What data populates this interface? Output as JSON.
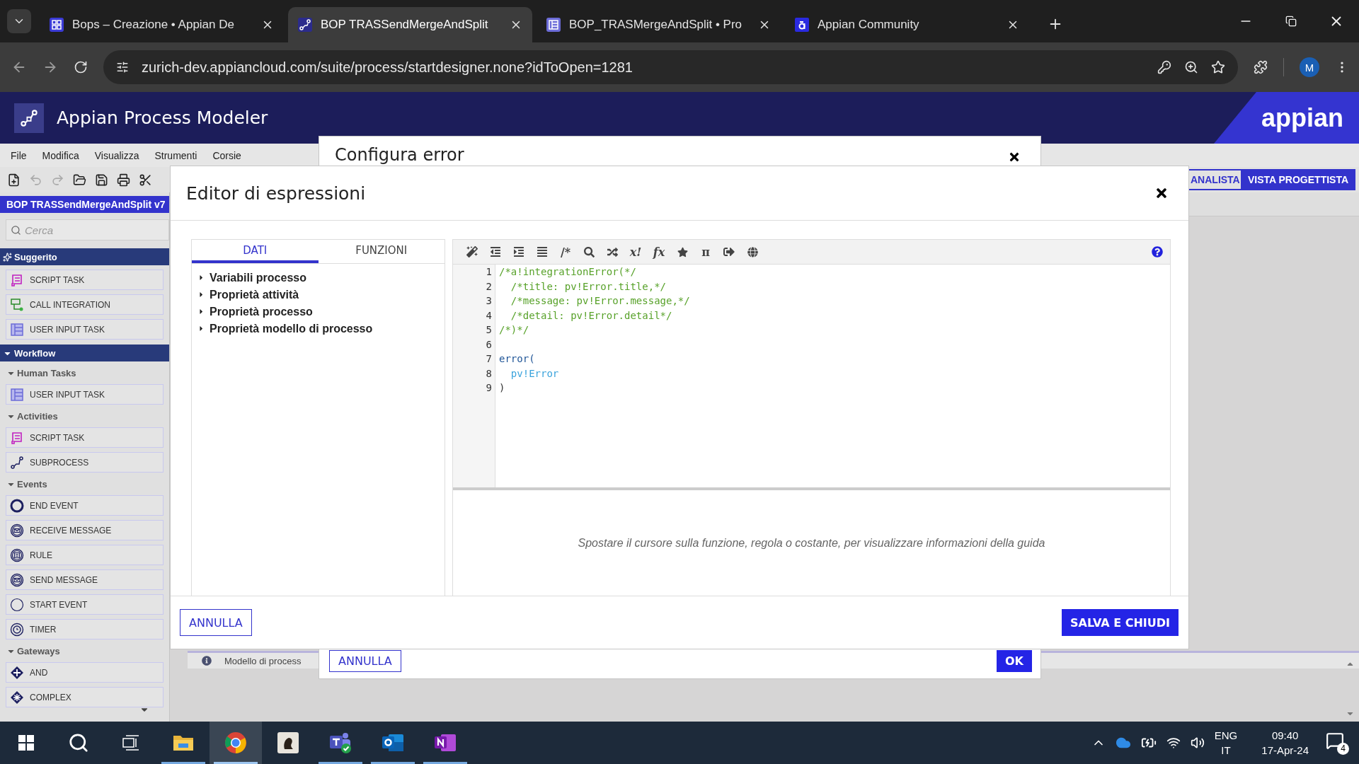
{
  "browser": {
    "tabs": [
      {
        "title": "Bops – Creazione • Appian De",
        "kind": "grid",
        "selected": false
      },
      {
        "title": "BOP TRASSendMergeAndSplit",
        "kind": "flow",
        "selected": true
      },
      {
        "title": "BOP_TRASMergeAndSplit • Pro",
        "kind": "form",
        "selected": false
      },
      {
        "title": "Appian Community",
        "kind": "community",
        "selected": false
      }
    ],
    "url": "zurich-dev.appiancloud.com/suite/process/startdesigner.none?idToOpen=1281",
    "profile": "M"
  },
  "app": {
    "title": "Appian Process Modeler",
    "brand": "appian",
    "menu": [
      "File",
      "Modifica",
      "Visualizza",
      "Strumenti",
      "Corsie"
    ],
    "views": [
      {
        "label": "ANALISTA",
        "selected": false
      },
      {
        "label": "VISTA PROGETTISTA",
        "selected": true
      }
    ],
    "model_title": "BOP TRASSendMergeAndSplit v7",
    "search": {
      "placeholder": "Cerca"
    },
    "palette": [
      {
        "label": "Suggerito",
        "kind": "suggested",
        "items": [
          {
            "label": "SCRIPT TASK",
            "kind": "script-task"
          },
          {
            "label": "CALL INTEGRATION",
            "kind": "call-integration"
          },
          {
            "label": "USER INPUT TASK",
            "kind": "user-input-task"
          }
        ]
      },
      {
        "label": "Workflow",
        "kind": "category",
        "expanded": true,
        "groups": [
          {
            "label": "Human Tasks",
            "expanded": true,
            "items": [
              {
                "label": "USER INPUT TASK",
                "kind": "user-input-task"
              }
            ]
          },
          {
            "label": "Activities",
            "expanded": true,
            "items": [
              {
                "label": "SCRIPT TASK",
                "kind": "script-task"
              },
              {
                "label": "SUBPROCESS",
                "kind": "subprocess"
              }
            ]
          },
          {
            "label": "Events",
            "expanded": true,
            "items": [
              {
                "label": "END EVENT",
                "kind": "end-event"
              },
              {
                "label": "RECEIVE MESSAGE",
                "kind": "receive-message"
              },
              {
                "label": "RULE",
                "kind": "rule"
              },
              {
                "label": "SEND MESSAGE",
                "kind": "send-message"
              },
              {
                "label": "START EVENT",
                "kind": "start-event"
              },
              {
                "label": "TIMER",
                "kind": "timer"
              }
            ]
          },
          {
            "label": "Gateways",
            "expanded": true,
            "items": [
              {
                "label": "AND",
                "kind": "and"
              },
              {
                "label": "COMPLEX",
                "kind": "complex"
              }
            ]
          }
        ]
      }
    ],
    "status_bar": "Modello di process"
  },
  "config_dialog": {
    "title": "Configura error",
    "cancel": "ANNULLA",
    "ok": "OK"
  },
  "editor_dialog": {
    "title": "Editor di espressioni",
    "tabs": [
      {
        "label": "DATI",
        "selected": true
      },
      {
        "label": "FUNZIONI",
        "selected": false
      }
    ],
    "tree": [
      {
        "label": "Variabili processo",
        "expanded": false
      },
      {
        "label": "Proprietà attività",
        "expanded": false
      },
      {
        "label": "Proprietà processo",
        "expanded": false
      },
      {
        "label": "Proprietà modello di processo",
        "expanded": false
      }
    ],
    "toolbar_glyphs": [
      "/*",
      "x!",
      "fx",
      "π"
    ],
    "code": [
      {
        "number": "1",
        "text": "/*a!integrationError(*/",
        "kind": "comment"
      },
      {
        "number": "2",
        "text": "  /*title: pv!Error.title,*/",
        "kind": "comment"
      },
      {
        "number": "3",
        "text": "  /*message: pv!Error.message,*/",
        "kind": "comment"
      },
      {
        "number": "4",
        "text": "  /*detail: pv!Error.detail*/",
        "kind": "comment"
      },
      {
        "number": "5",
        "text": "/*)*/",
        "kind": "comment"
      },
      {
        "number": "6",
        "kind": "plain"
      },
      {
        "number": "7",
        "text": "error(",
        "kind": "function"
      },
      {
        "number": "8",
        "text": "  pv!Error",
        "kind": "variable"
      },
      {
        "number": "9",
        "text": ")",
        "kind": "plain"
      }
    ],
    "help": "Spostare il cursore sulla funzione, regola o costante, per visualizzare informazioni della guida",
    "cancel": "ANNULLA",
    "save": "SALVA E CHIUDI"
  },
  "taskbar": {
    "buttons": [
      {
        "selected": false,
        "running": false
      },
      {
        "selected": false,
        "running": false
      },
      {
        "selected": false,
        "running": false
      },
      {
        "selected": false,
        "running": true
      },
      {
        "selected": true,
        "running": true
      },
      {
        "selected": false,
        "running": false
      },
      {
        "selected": false,
        "running": true
      },
      {
        "selected": false,
        "running": true
      },
      {
        "selected": false,
        "running": true
      }
    ],
    "language": "ENG",
    "layout": "IT",
    "time": "09:40",
    "date": "17-Apr-24",
    "notifications": "4"
  }
}
